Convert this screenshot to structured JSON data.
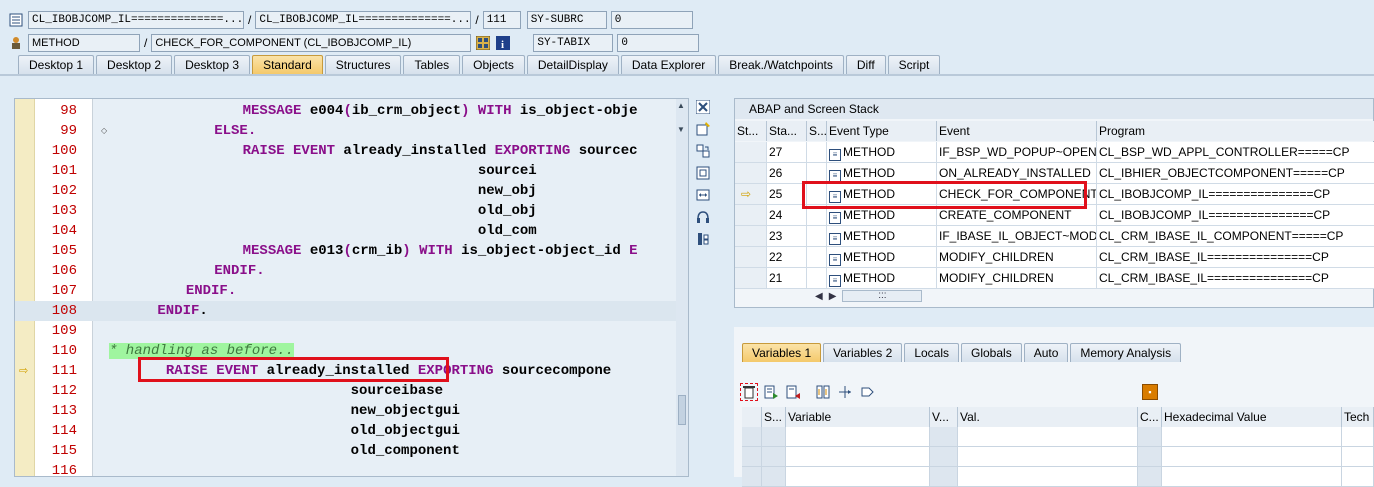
{
  "header": {
    "row1": {
      "class_field": "CL_IBOBJCOMP_IL==============...",
      "include_field": "CL_IBOBJCOMP_IL==============...",
      "line_field": "111",
      "sysvar_name": "SY-SUBRC",
      "sysvar_value": "0"
    },
    "row2": {
      "type_field": "METHOD",
      "method_field": "CHECK_FOR_COMPONENT (CL_IBOBJCOMP_IL)",
      "sysvar_name": "SY-TABIX",
      "sysvar_value": "0"
    },
    "separator": "/"
  },
  "tabs": [
    {
      "label": "Desktop 1",
      "active": false
    },
    {
      "label": "Desktop 2",
      "active": false
    },
    {
      "label": "Desktop 3",
      "active": false
    },
    {
      "label": "Standard",
      "active": true
    },
    {
      "label": "Structures",
      "active": false
    },
    {
      "label": "Tables",
      "active": false
    },
    {
      "label": "Objects",
      "active": false
    },
    {
      "label": "DetailDisplay",
      "active": false
    },
    {
      "label": "Data Explorer",
      "active": false
    },
    {
      "label": "Break./Watchpoints",
      "active": false
    },
    {
      "label": "Diff",
      "active": false
    },
    {
      "label": "Script",
      "active": false
    }
  ],
  "code": {
    "lines": [
      {
        "num": "98",
        "segs": [
          [
            "    ",
            ""
          ],
          [
            "MESSAGE",
            "kw"
          ],
          [
            " e004",
            ""
          ],
          [
            "(",
            "kw"
          ],
          [
            "ib_crm_object",
            ""
          ],
          [
            ")",
            "kw"
          ],
          [
            " ",
            ""
          ],
          [
            "WITH",
            "kw"
          ],
          [
            " is_object-obje",
            ""
          ]
        ]
      },
      {
        "num": "99",
        "segs": [
          [
            "   ",
            ""
          ],
          [
            "ELSE.",
            "kw"
          ]
        ]
      },
      {
        "num": "100",
        "segs": [
          [
            "    ",
            ""
          ],
          [
            "RAISE EVENT",
            "kw"
          ],
          [
            " already_installed ",
            ""
          ],
          [
            "EXPORTING",
            "kw"
          ],
          [
            " sourcec",
            ""
          ]
        ]
      },
      {
        "num": "101",
        "segs": [
          [
            "                                ",
            ""
          ],
          [
            "sourcei",
            ""
          ]
        ]
      },
      {
        "num": "102",
        "segs": [
          [
            "                                ",
            ""
          ],
          [
            "new_obj",
            ""
          ]
        ]
      },
      {
        "num": "103",
        "segs": [
          [
            "                                ",
            ""
          ],
          [
            "old_obj",
            ""
          ]
        ]
      },
      {
        "num": "104",
        "segs": [
          [
            "                                ",
            ""
          ],
          [
            "old_com",
            ""
          ]
        ]
      },
      {
        "num": "105",
        "segs": [
          [
            "    ",
            ""
          ],
          [
            "MESSAGE",
            "kw"
          ],
          [
            " e013",
            ""
          ],
          [
            "(",
            "kw"
          ],
          [
            "crm_ib",
            ""
          ],
          [
            ")",
            "kw"
          ],
          [
            " ",
            ""
          ],
          [
            "WITH",
            "kw"
          ],
          [
            " is_object-object_id ",
            ""
          ],
          [
            "E",
            "kw"
          ]
        ]
      },
      {
        "num": "106",
        "segs": [
          [
            "   ",
            ""
          ],
          [
            "ENDIF.",
            "kw"
          ]
        ]
      },
      {
        "num": "107",
        "segs": [
          [
            "  ",
            ""
          ],
          [
            "ENDIF.",
            "kw"
          ]
        ]
      },
      {
        "num": "108",
        "segs": [
          [
            " ",
            ""
          ],
          [
            "ENDIF",
            "kw"
          ],
          [
            ".",
            ""
          ]
        ]
      },
      {
        "num": "109",
        "segs": []
      },
      {
        "num": "110",
        "segs": [
          [
            "* handling as before..",
            "comment"
          ]
        ]
      },
      {
        "num": "111",
        "segs": [
          [
            "  ",
            ""
          ],
          [
            "RAISE EVENT",
            "kw"
          ],
          [
            " already_installed ",
            ""
          ],
          [
            "EXPORTING",
            "kw"
          ],
          [
            " sourcecompone",
            ""
          ]
        ]
      },
      {
        "num": "112",
        "segs": [
          [
            "                        ",
            ""
          ],
          [
            "sourceibase",
            ""
          ]
        ]
      },
      {
        "num": "113",
        "segs": [
          [
            "                        ",
            ""
          ],
          [
            "new_objectgui",
            ""
          ]
        ]
      },
      {
        "num": "114",
        "segs": [
          [
            "                        ",
            ""
          ],
          [
            "old_objectgui",
            ""
          ]
        ]
      },
      {
        "num": "115",
        "segs": [
          [
            "                        ",
            ""
          ],
          [
            "old_component",
            ""
          ]
        ]
      },
      {
        "num": "116",
        "segs": []
      }
    ]
  },
  "stack": {
    "title": "ABAP and Screen Stack",
    "columns": [
      "St...",
      "Sta...",
      "S...",
      "Event Type",
      "Event",
      "Program"
    ],
    "rows": [
      {
        "level": "27",
        "type": "METHOD",
        "event": "IF_BSP_WD_POPUP~OPEN",
        "program": "CL_BSP_WD_APPL_CONTROLLER=====CP",
        "current": false
      },
      {
        "level": "26",
        "type": "METHOD",
        "event": "ON_ALREADY_INSTALLED",
        "program": "CL_IBHIER_OBJECTCOMPONENT=====CP",
        "current": false
      },
      {
        "level": "25",
        "type": "METHOD",
        "event": "CHECK_FOR_COMPONENT",
        "program": "CL_IBOBJCOMP_IL===============CP",
        "current": true
      },
      {
        "level": "24",
        "type": "METHOD",
        "event": "CREATE_COMPONENT",
        "program": "CL_IBOBJCOMP_IL===============CP",
        "current": false
      },
      {
        "level": "23",
        "type": "METHOD",
        "event": "IF_IBASE_IL_OBJECT~MOD...",
        "program": "CL_CRM_IBASE_IL_COMPONENT=====CP",
        "current": false
      },
      {
        "level": "22",
        "type": "METHOD",
        "event": "MODIFY_CHILDREN",
        "program": "CL_CRM_IBASE_IL===============CP",
        "current": false
      },
      {
        "level": "21",
        "type": "METHOD",
        "event": "MODIFY_CHILDREN",
        "program": "CL_CRM_IBASE_IL===============CP",
        "current": false
      }
    ],
    "scroll_glyph": ":::"
  },
  "variables": {
    "tabs": [
      {
        "label": "Variables 1",
        "active": true
      },
      {
        "label": "Variables 2",
        "active": false
      },
      {
        "label": "Locals",
        "active": false
      },
      {
        "label": "Globals",
        "active": false
      },
      {
        "label": "Auto",
        "active": false
      },
      {
        "label": "Memory Analysis",
        "active": false
      }
    ],
    "columns": [
      "S...",
      "Variable",
      "V...",
      "Val.",
      "C...",
      "Hexadecimal Value",
      "Tech"
    ]
  },
  "colors": {
    "highlight_box": "#e0101b",
    "keyword": "#8a0f8a",
    "line_number": "#c00000",
    "active_tab": "#f4c96b",
    "comment_bg": "#9ff59f"
  }
}
